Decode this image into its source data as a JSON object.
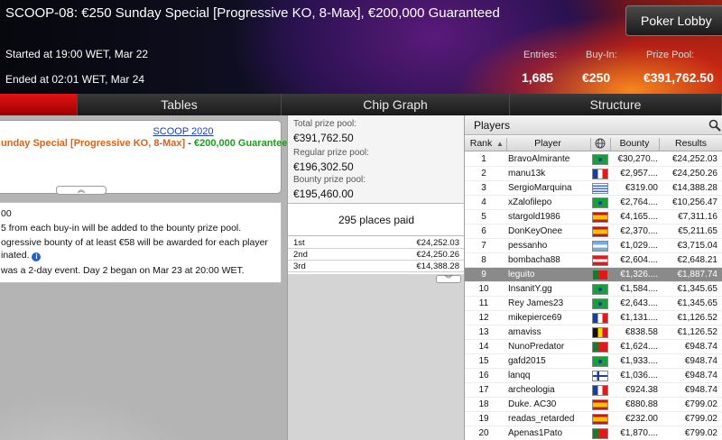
{
  "header": {
    "title": "SCOOP-08: €250 Sunday Special [Progressive KO, 8-Max], €200,000 Guaranteed",
    "started": "Started at 19:00 WET, Mar 22",
    "ended": "Ended at 02:01 WET, Mar 24",
    "lobby_button": "Poker Lobby",
    "entries_label": "Entries:",
    "entries_value": "1,685",
    "buyin_label": "Buy-In:",
    "buyin_value": "€250",
    "prizepool_label": "Prize Pool:",
    "prizepool_value": "€391,762.50"
  },
  "tabs": [
    {
      "label": ""
    },
    {
      "label": "Tables"
    },
    {
      "label": "Chip Graph"
    },
    {
      "label": "Structure"
    }
  ],
  "info": {
    "series_link": "SCOOP 2020",
    "event_orange": "unday Special [Progressive KO, 8-Max]",
    "event_dash": " - ",
    "event_green": "€200,000 Guaranteed",
    "line1": "00",
    "line2": "5 from each buy-in will be added to the bounty prize pool.",
    "line3": "ogressive bounty of at least €58 will be awarded for each player",
    "line4": "inated.",
    "line5": "was a 2-day event. Day 2 began on Mar 23 at 20:00 WET."
  },
  "prize": {
    "total_label": "Total prize pool:",
    "total_value": "€391,762.50",
    "regular_label": "Regular prize pool:",
    "regular_value": "€196,302.50",
    "bounty_label": "Bounty prize pool:",
    "bounty_value": "€195,460.00",
    "places_paid": "295 places paid",
    "payouts": [
      {
        "place": "1st",
        "amount": "€24,252.03"
      },
      {
        "place": "2nd",
        "amount": "€24,250.26"
      },
      {
        "place": "3rd",
        "amount": "€14,388.28"
      }
    ]
  },
  "players": {
    "title": "Players",
    "headers": {
      "rank": "Rank",
      "player": "Player",
      "bounty": "Bounty",
      "results": "Results"
    },
    "rows": [
      {
        "rank": "1",
        "name": "BravoAlmirante",
        "flag": "brazil",
        "bounty": "€30,270...",
        "result": "€24,252.03"
      },
      {
        "rank": "2",
        "name": "manu13k",
        "flag": "france",
        "bounty": "€2,957....",
        "result": "€24,250.26"
      },
      {
        "rank": "3",
        "name": "SergioMarquina",
        "flag": "uruguay",
        "bounty": "€319.00",
        "result": "€14,388.28"
      },
      {
        "rank": "4",
        "name": "xZalofilepo",
        "flag": "brazil",
        "bounty": "€2,764....",
        "result": "€10,256.47"
      },
      {
        "rank": "5",
        "name": "stargold1986",
        "flag": "spain",
        "bounty": "€4,165....",
        "result": "€7,311.16"
      },
      {
        "rank": "6",
        "name": "DonKeyOnee",
        "flag": "spain",
        "bounty": "€2,370....",
        "result": "€5,211.65"
      },
      {
        "rank": "7",
        "name": "pessanho",
        "flag": "argentina",
        "bounty": "€1,029....",
        "result": "€3,715.04"
      },
      {
        "rank": "8",
        "name": "bombacha88",
        "flag": "austria",
        "bounty": "€2,604....",
        "result": "€2,648.21"
      },
      {
        "rank": "9",
        "name": "leguito",
        "flag": "portugal",
        "bounty": "€1,326....",
        "result": "€1,887.74",
        "selected": true
      },
      {
        "rank": "10",
        "name": "InsanitY.gg",
        "flag": "brazil",
        "bounty": "€1,584....",
        "result": "€1,345.65"
      },
      {
        "rank": "11",
        "name": "Rey James23",
        "flag": "brazil",
        "bounty": "€2,643....",
        "result": "€1,345.65"
      },
      {
        "rank": "12",
        "name": "mikepierce69",
        "flag": "france",
        "bounty": "€1,131....",
        "result": "€1,126.52"
      },
      {
        "rank": "13",
        "name": "amaviss",
        "flag": "belgium",
        "bounty": "€838.58",
        "result": "€1,126.52"
      },
      {
        "rank": "14",
        "name": "NunoPredator",
        "flag": "portugal",
        "bounty": "€1,624....",
        "result": "€948.74"
      },
      {
        "rank": "15",
        "name": "gafd2015",
        "flag": "brazil",
        "bounty": "€1,933....",
        "result": "€948.74"
      },
      {
        "rank": "16",
        "name": "lanqq",
        "flag": "finland",
        "bounty": "€1,036....",
        "result": "€948.74"
      },
      {
        "rank": "17",
        "name": "archeologia",
        "flag": "france",
        "bounty": "€924.38",
        "result": "€948.74"
      },
      {
        "rank": "18",
        "name": "Duke. AC30",
        "flag": "spain",
        "bounty": "€880.88",
        "result": "€799.02"
      },
      {
        "rank": "19",
        "name": "readas_retarded",
        "flag": "spain",
        "bounty": "€232.00",
        "result": "€799.02"
      },
      {
        "rank": "20",
        "name": "Apenas1Pato",
        "flag": "portugal",
        "bounty": "€1,870....",
        "result": "€799.02"
      }
    ]
  }
}
